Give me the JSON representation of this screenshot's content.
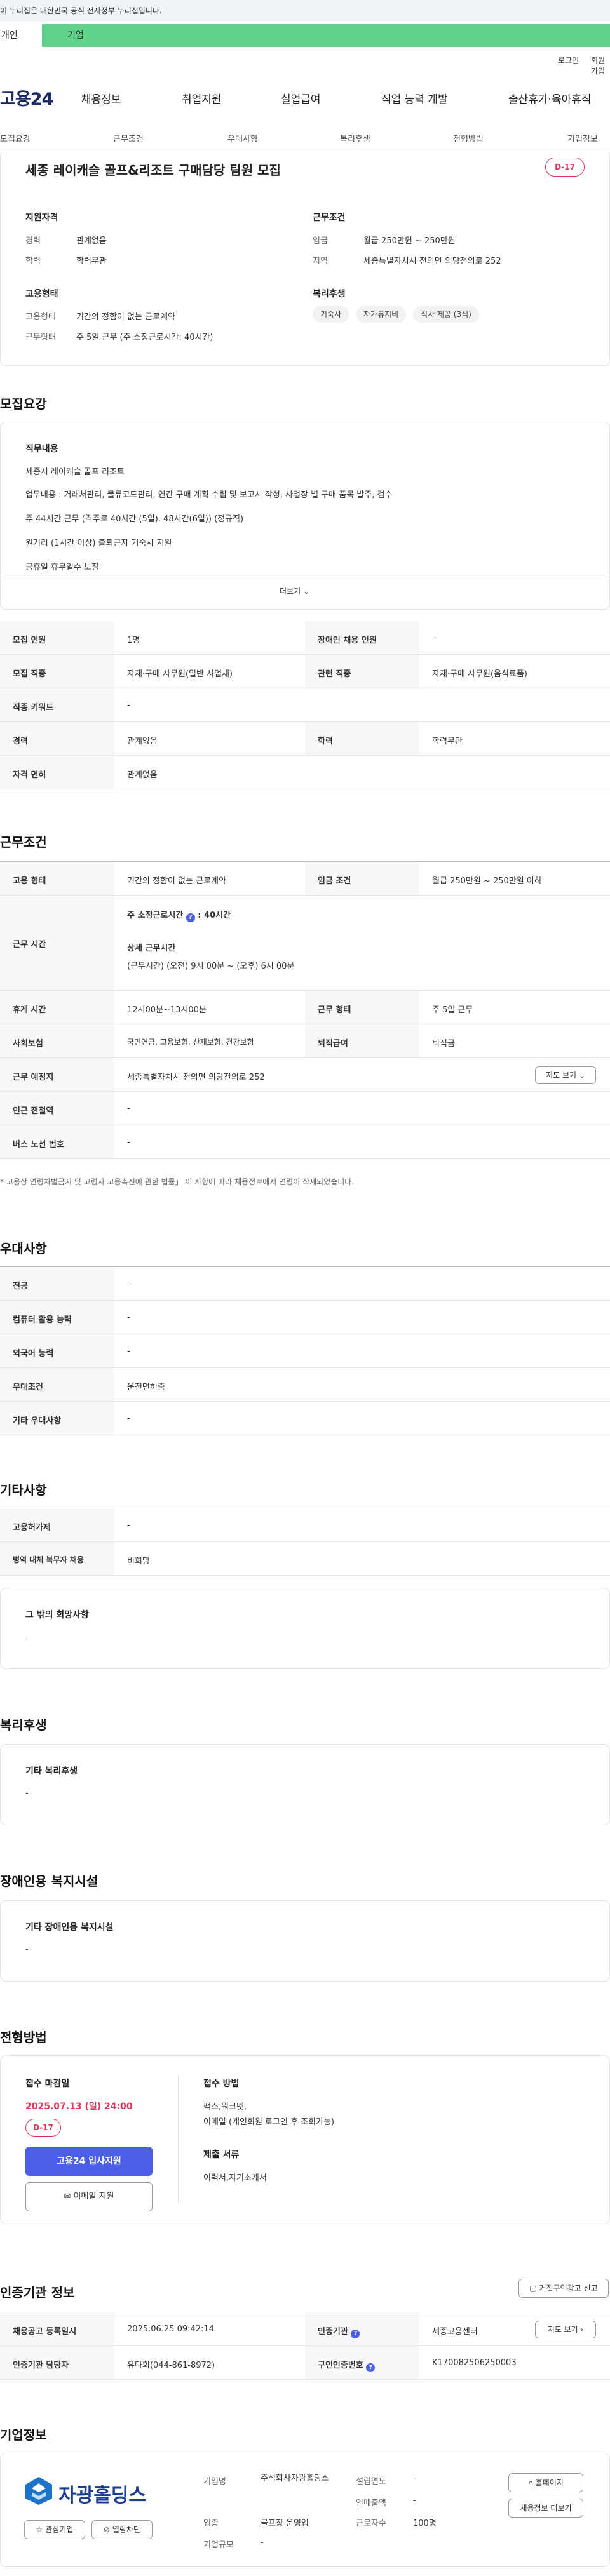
{
  "gov_banner": "이 누리집은 대한민국 공식 전자정부 누리집입니다.",
  "tabs": {
    "individual": "개인",
    "business": "기업"
  },
  "util": {
    "login": "로그인",
    "join": "회원가입"
  },
  "logo": "고용24",
  "gnb": [
    "채용정보",
    "취업지원",
    "실업급여",
    "직업 능력 개발",
    "출산휴가·육아휴직"
  ],
  "subnav": [
    "모집요강",
    "근무조건",
    "우대사항",
    "복리후생",
    "전형방법",
    "기업정보"
  ],
  "job": {
    "title": "세종 레이캐슬 골프&리조트 구매담당 팀원 모집",
    "dday": "D-17",
    "qual_h": "지원자격",
    "career_l": "경력",
    "career_v": "관계없음",
    "edu_l": "학력",
    "edu_v": "학력무관",
    "emp_h": "고용형태",
    "emptype_l": "고용형태",
    "emptype_v": "기간의 정함이 없는 근로계약",
    "worktype_l": "근무형태",
    "worktype_v": "주 5일 근무 (주 소정근로시간: 40시간)",
    "cond_h": "근무조건",
    "wage_l": "임금",
    "wage_v": "월급 250만원 ~ 250만원",
    "region_l": "지역",
    "region_v": "세종특별자치시 전의면 의당전의로 252",
    "welfare_h": "복리후생",
    "welfare_chips": [
      "기숙사",
      "자가유지비",
      "식사 제공 (3식)"
    ]
  },
  "recruit": {
    "sec": "모집요강",
    "duty_h": "직무내용",
    "lines": [
      "세종시 레이캐슬 골프 리조트",
      "업무내용 : 거래처관리, 물류코드관리, 연간 구매 계획 수립 및 보고서 작성, 사업장 별 구매 품목 발주, 검수",
      "주 44시간 근무 (격주로 40시간 (5일), 48시간(6일)) (정규직)",
      "원거리 (1시간 이상) 출퇴근자 기숙사 지원",
      "공휴일 휴무일수 보장"
    ],
    "more": "더보기",
    "rows": [
      [
        "모집 인원",
        "1명",
        "장애인 채용 인원",
        "-"
      ],
      [
        "모집 직종",
        "자재·구매 사무원(일반 사업체)",
        "관련 직종",
        "자재·구매 사무원(음식료품)"
      ],
      [
        "직종 키워드",
        "-"
      ],
      [
        "경력",
        "관계없음",
        "학력",
        "학력무관"
      ],
      [
        "자격 면허",
        "관계없음"
      ]
    ]
  },
  "cond": {
    "sec": "근무조건",
    "r1": [
      "고용 형태",
      "기간의 정함이 없는 근로계약",
      "임금 조건",
      "월급 250만원 ~ 250만원 이하"
    ],
    "hours_l": "근무 시간",
    "hours_a": "주 소정근로시간",
    "hours_a_v": "40시간",
    "hours_b": "상세 근무시간",
    "hours_b_v": "(근무시간) (오전) 9시 00분 ~ (오후) 6시 00분",
    "r3": [
      "휴게 시간",
      "12시00분~13시00분",
      "근무 형태",
      "주 5일 근무"
    ],
    "r4": [
      "사회보험",
      "국민연금, 고용보험, 산재보험, 건강보험",
      "퇴직급여",
      "퇴직금"
    ],
    "r5": [
      "근무 예정지",
      "세종특별자치시 전의면 의당전의로 252"
    ],
    "map_btn": "지도 보기",
    "r6": [
      "인근 전철역",
      "-"
    ],
    "r7": [
      "버스 노선 번호",
      "-"
    ],
    "note": "* 고용상 연령차별금지 및 고령자 고용촉진에 관한 법률」 이 사항에 따라 채용정보에서 연령이 삭제되었습니다."
  },
  "pref": {
    "sec": "우대사항",
    "rows": [
      [
        "전공",
        "-"
      ],
      [
        "컴퓨터 활용 능력",
        "-"
      ],
      [
        "외국어 능력",
        "-"
      ],
      [
        "우대조건",
        "운전면허증"
      ],
      [
        "기타 우대사항",
        "-"
      ]
    ]
  },
  "etc": {
    "sec": "기타사항",
    "rows": [
      [
        "고용허가제",
        "-"
      ],
      [
        "병역 대체 복무자 채용",
        "비희망"
      ]
    ],
    "other_h": "그 밖의 희망사항",
    "other_v": "-"
  },
  "welfare": {
    "sec": "복리후생",
    "h": "기타 복리후생",
    "v": "-"
  },
  "disabled": {
    "sec": "장애인용 복지시설",
    "h": "기타 장애인용 복지시설",
    "v": "-"
  },
  "process": {
    "sec": "전형방법",
    "deadline_h": "접수 마감일",
    "deadline": "2025.07.13 (일) 24:00",
    "dday": "D-17",
    "apply": "고용24 입사지원",
    "email": "이메일 지원",
    "method_h": "접수 방법",
    "method_v1": "팩스,워크넷,",
    "method_v2": "이메일 (개인회원 로그인 후 조회가능)",
    "docs_h": "제출 서류",
    "docs_v": "이력서,자기소개서"
  },
  "agency": {
    "sec": "인증기관 정보",
    "report": "거짓구인광고 신고",
    "r1": [
      "채용공고 등록일시",
      "2025.06.25 09:42:14",
      "인증기관",
      "세종고용센터"
    ],
    "map": "지도 보기",
    "r2": [
      "인증기관 담당자",
      "유다희(044-861-8972)",
      "구인인증번호",
      "K170082506250003"
    ]
  },
  "company": {
    "sec": "기업정보",
    "name": "자광홀딩스",
    "interest": "관심기업",
    "block": "열람차단",
    "f1": [
      "기업명",
      "주식회사자광홀딩스",
      "설립연도",
      "-"
    ],
    "f2": [
      "업종",
      "골프장 운영업",
      "연매출액",
      "-"
    ],
    "f3": [
      "기업규모",
      "-",
      "근로자수",
      "100명"
    ],
    "home": "홈페이지",
    "more": "채용정보 더보기"
  }
}
